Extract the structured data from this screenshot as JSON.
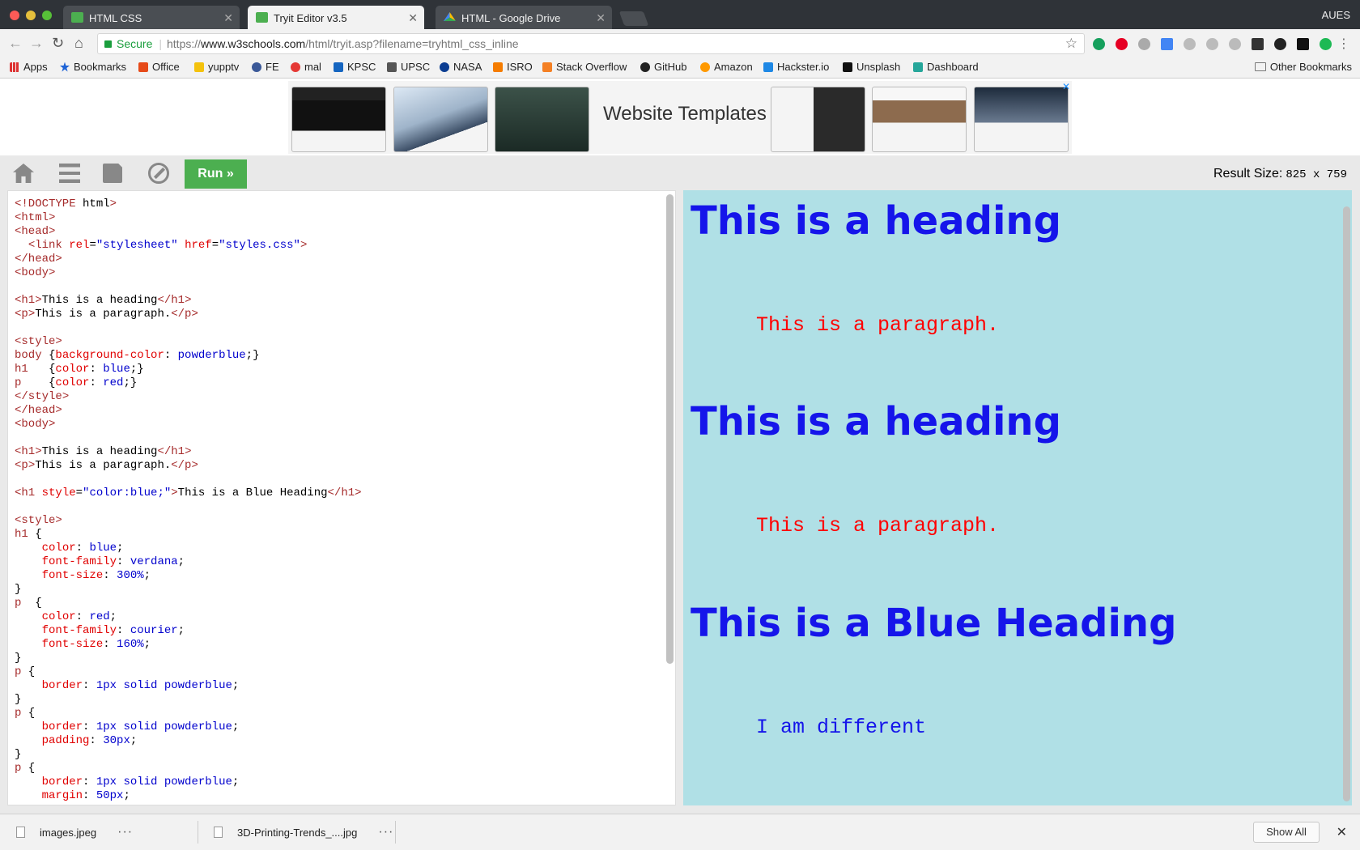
{
  "browser": {
    "profile": "AUES",
    "tabs": [
      {
        "title": "HTML CSS",
        "active": false,
        "icon": "w3schools-favicon"
      },
      {
        "title": "Tryit Editor v3.5",
        "active": true,
        "icon": "w3schools-favicon"
      },
      {
        "title": "HTML - Google Drive",
        "active": false,
        "icon": "google-drive-favicon"
      }
    ],
    "omnibox": {
      "secure_label": "Secure",
      "url_prefix": "https://",
      "url_host": "www.w3schools.com",
      "url_path": "/html/tryit.asp?filename=tryhtml_css_inline"
    },
    "bookmarks": [
      "Apps",
      "Bookmarks",
      "Office",
      "yupptv",
      "FE",
      "mal",
      "KPSC",
      "UPSC",
      "NASA",
      "ISRO",
      "Stack Overflow",
      "GitHub",
      "Amazon",
      "Hackster.io",
      "Unsplash",
      "Dashboard"
    ],
    "other_bookmarks": "Other Bookmarks"
  },
  "ad": {
    "title": "Website Templates",
    "close_glyph": "✕"
  },
  "editor": {
    "run_label": "Run »",
    "result_size_label": "Result Size:",
    "result_size_value": "825 x 759"
  },
  "code_lines": [
    "<!DOCTYPE html>",
    "<html>",
    "<head>",
    "  <link rel=\"stylesheet\" href=\"styles.css\">",
    "</head>",
    "<body>",
    "",
    "<h1>This is a heading</h1>",
    "<p>This is a paragraph.</p>",
    "",
    "<style>",
    "body {background-color: powderblue;}",
    "h1   {color: blue;}",
    "p    {color: red;}",
    "</style>",
    "</head>",
    "<body>",
    "",
    "<h1>This is a heading</h1>",
    "<p>This is a paragraph.</p>",
    "",
    "<h1 style=\"color:blue;\">This is a Blue Heading</h1>",
    "",
    "<style>",
    "h1 {",
    "    color: blue;",
    "    font-family: verdana;",
    "    font-size: 300%;",
    "}",
    "p  {",
    "    color: red;",
    "    font-family: courier;",
    "    font-size: 160%;",
    "}",
    "p {",
    "    border: 1px solid powderblue;",
    "}",
    "p {",
    "    border: 1px solid powderblue;",
    "    padding: 30px;",
    "}",
    "p {",
    "    border: 1px solid powderblue;",
    "    margin: 50px;"
  ],
  "result": {
    "heading1": "This is a heading",
    "para1": "This is a paragraph.",
    "heading2": "This is a heading",
    "para2": "This is a paragraph.",
    "heading3": "This is a Blue Heading",
    "para3": "I am different",
    "background_color": "#b0e0e6",
    "heading_color": "#1515ea",
    "para_color": "#ff0000"
  },
  "downloads": {
    "items": [
      "images.jpeg",
      "3D-Printing-Trends_....jpg"
    ],
    "show_all_label": "Show All"
  }
}
